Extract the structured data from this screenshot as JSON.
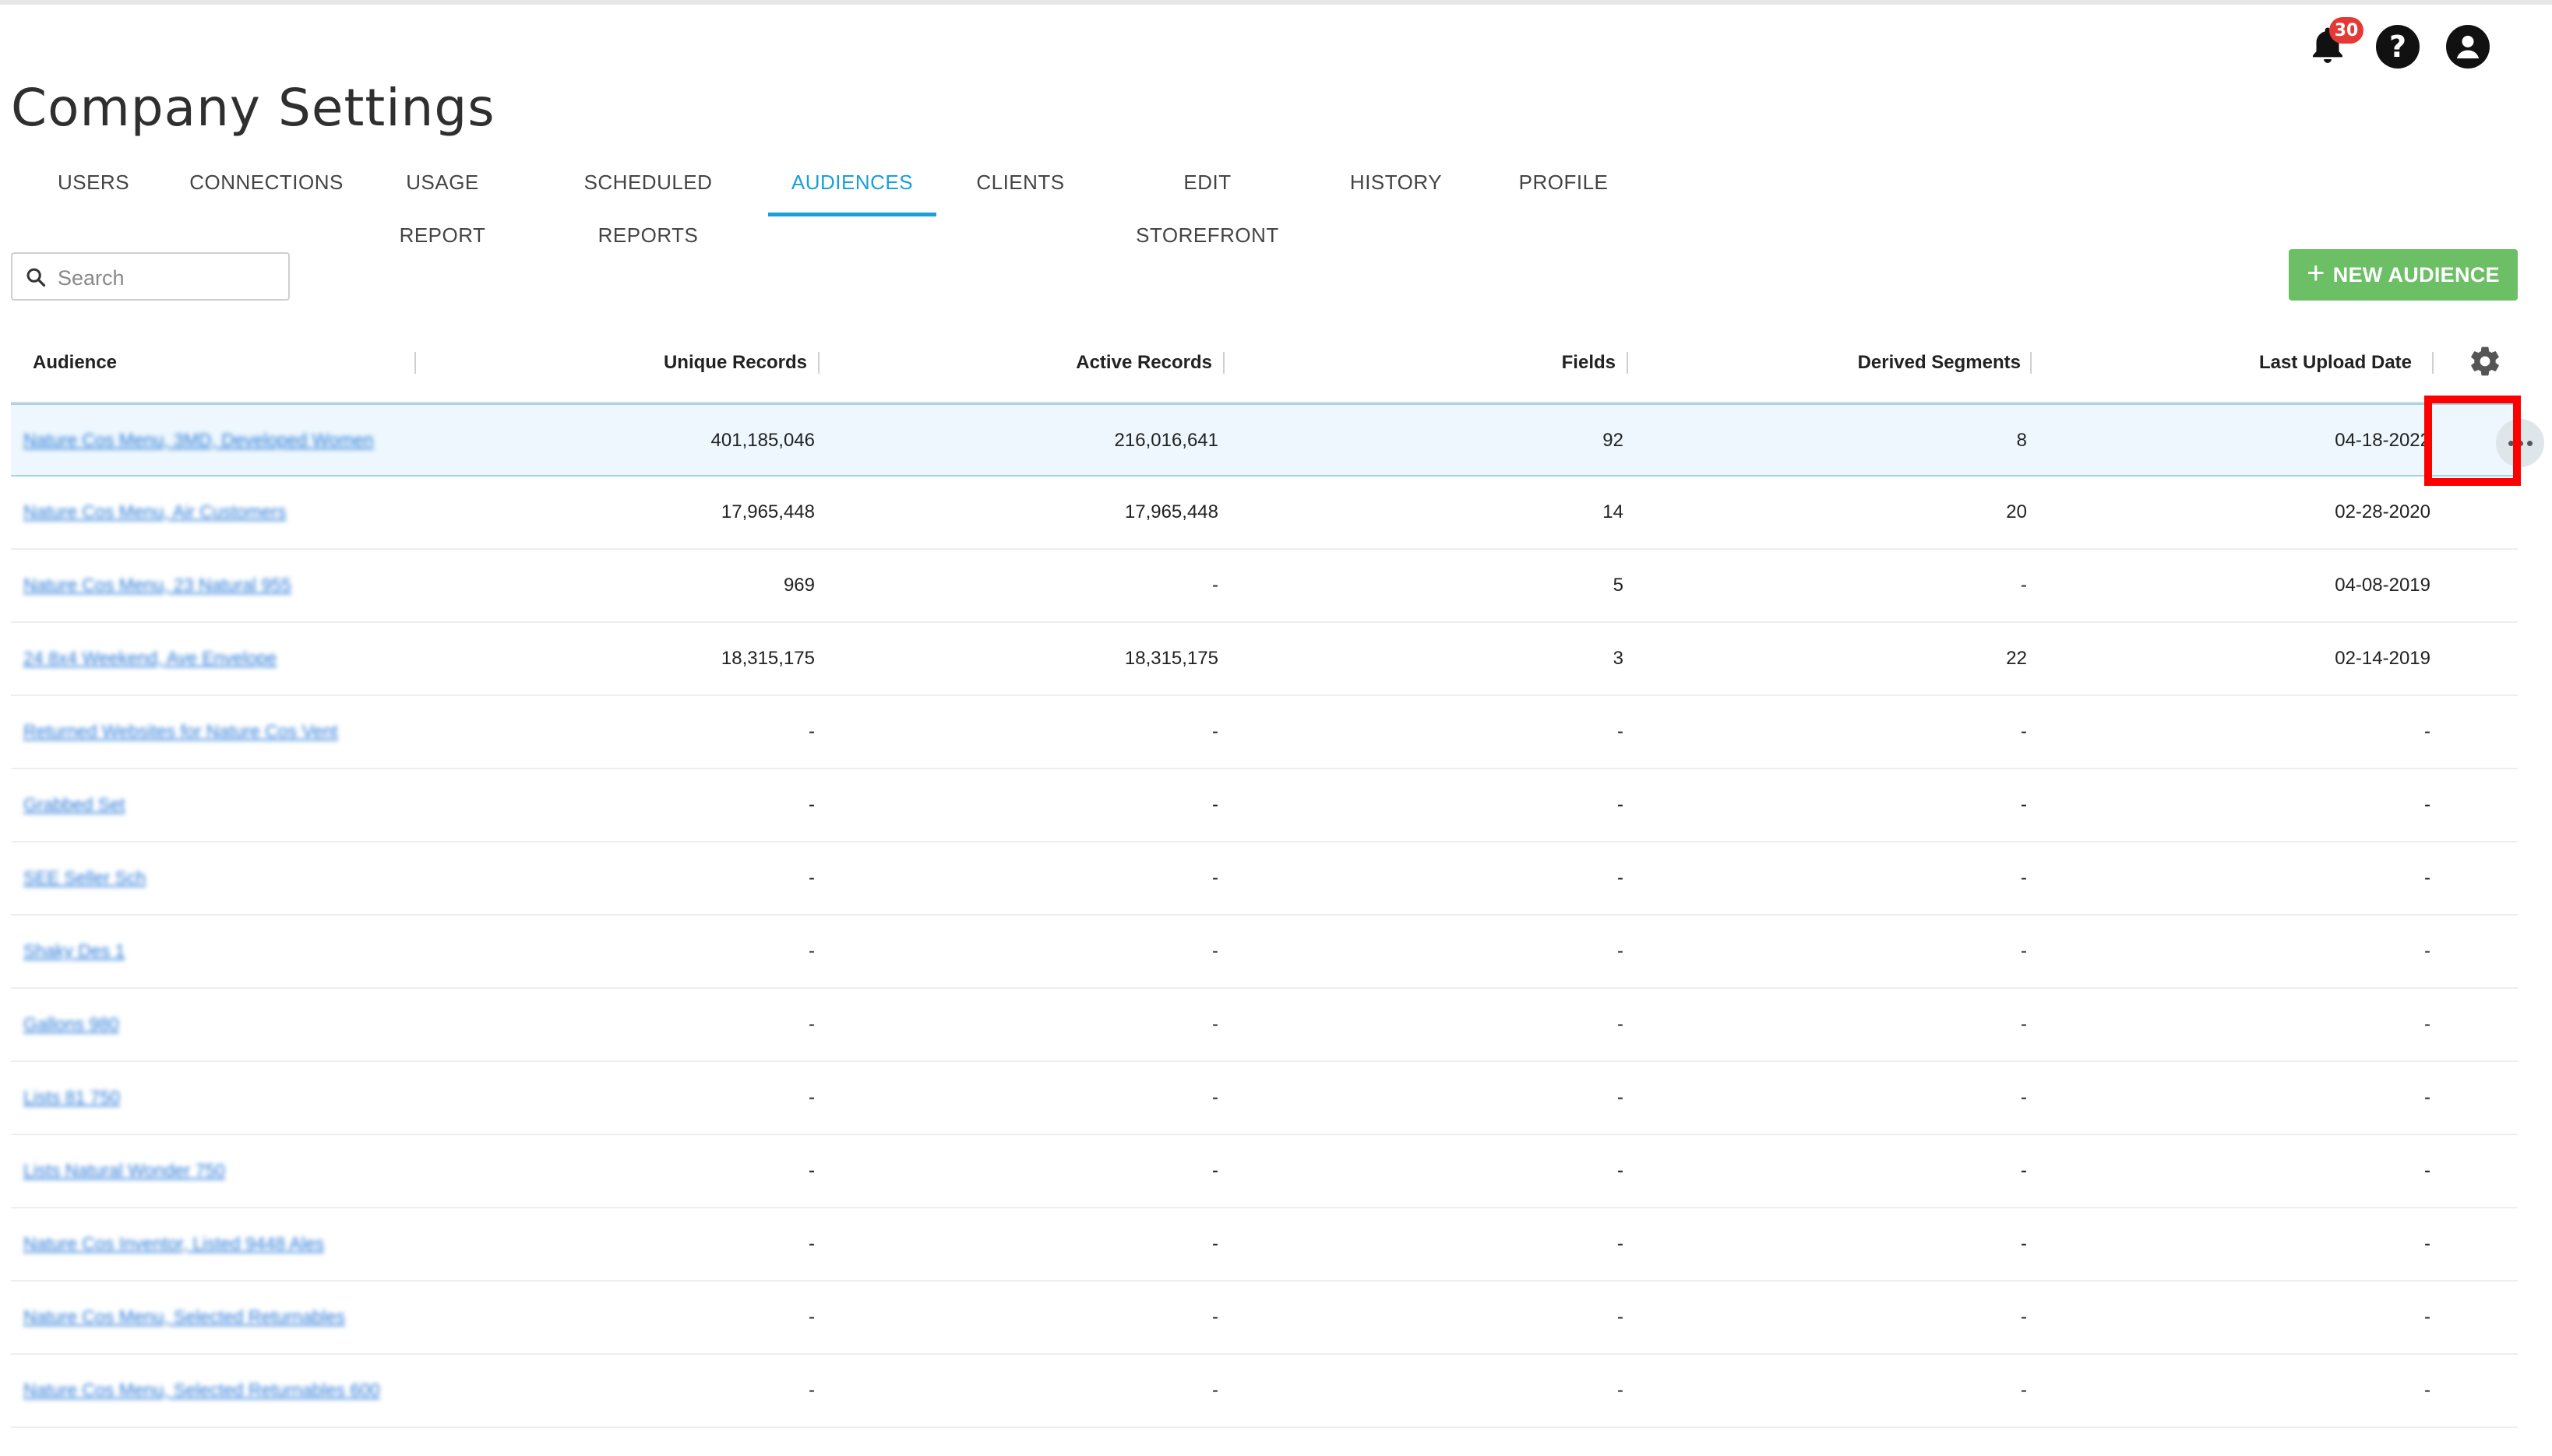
{
  "page": {
    "title": "Company Settings"
  },
  "header": {
    "notifications_count": "30",
    "icons": [
      "bell-icon",
      "help-icon",
      "account-icon"
    ]
  },
  "tabs": [
    {
      "label": "USERS"
    },
    {
      "label": "CONNECTIONS"
    },
    {
      "label": "USAGE REPORT"
    },
    {
      "label": "SCHEDULED REPORTS"
    },
    {
      "label": "AUDIENCES",
      "active": true
    },
    {
      "label": "CLIENTS"
    },
    {
      "label": "EDIT STOREFRONT"
    },
    {
      "label": "HISTORY"
    },
    {
      "label": "PROFILE"
    }
  ],
  "search": {
    "placeholder": "Search",
    "value": ""
  },
  "actions": {
    "new_audience": "NEW AUDIENCE"
  },
  "colors": {
    "accent": "#1a9fd8",
    "primary_button": "#6dbf66",
    "badge": "#e53935",
    "highlight": "#ff0000"
  },
  "table": {
    "columns": [
      "Audience",
      "Unique Records",
      "Active Records",
      "Fields",
      "Derived Segments",
      "Last Upload Date"
    ],
    "rows": [
      {
        "name": "Nature Cos Menu, 3MD, Developed Women",
        "unique": "401,185,046",
        "active": "216,016,641",
        "fields": "92",
        "segments": "8",
        "date": "04-18-2022"
      },
      {
        "name": "Nature Cos Menu, Air Customers",
        "unique": "17,965,448",
        "active": "17,965,448",
        "fields": "14",
        "segments": "20",
        "date": "02-28-2020"
      },
      {
        "name": "Nature Cos Menu, 23 Natural 955",
        "unique": "969",
        "active": "-",
        "fields": "5",
        "segments": "-",
        "date": "04-08-2019"
      },
      {
        "name": "24 8x4 Weekend, Ave Envelope",
        "unique": "18,315,175",
        "active": "18,315,175",
        "fields": "3",
        "segments": "22",
        "date": "02-14-2019"
      },
      {
        "name": "Returned Websites for Nature Cos Vent",
        "unique": "-",
        "active": "-",
        "fields": "-",
        "segments": "-",
        "date": "-"
      },
      {
        "name": "Grabbed Set",
        "unique": "-",
        "active": "-",
        "fields": "-",
        "segments": "-",
        "date": "-"
      },
      {
        "name": "SEE Seller Sch",
        "unique": "-",
        "active": "-",
        "fields": "-",
        "segments": "-",
        "date": "-"
      },
      {
        "name": "Shaky Des 1",
        "unique": "-",
        "active": "-",
        "fields": "-",
        "segments": "-",
        "date": "-"
      },
      {
        "name": "Gallons 980",
        "unique": "-",
        "active": "-",
        "fields": "-",
        "segments": "-",
        "date": "-"
      },
      {
        "name": "Lists 81 750",
        "unique": "-",
        "active": "-",
        "fields": "-",
        "segments": "-",
        "date": "-"
      },
      {
        "name": "Lists Natural Wonder 750",
        "unique": "-",
        "active": "-",
        "fields": "-",
        "segments": "-",
        "date": "-"
      },
      {
        "name": "Nature Cos Inventor, Listed 9448 Ales",
        "unique": "-",
        "active": "-",
        "fields": "-",
        "segments": "-",
        "date": "-"
      },
      {
        "name": "Nature Cos Menu, Selected Returnables",
        "unique": "-",
        "active": "-",
        "fields": "-",
        "segments": "-",
        "date": "-"
      },
      {
        "name": "Nature Cos Menu, Selected Returnables 600",
        "unique": "-",
        "active": "-",
        "fields": "-",
        "segments": "-",
        "date": "-"
      }
    ]
  }
}
